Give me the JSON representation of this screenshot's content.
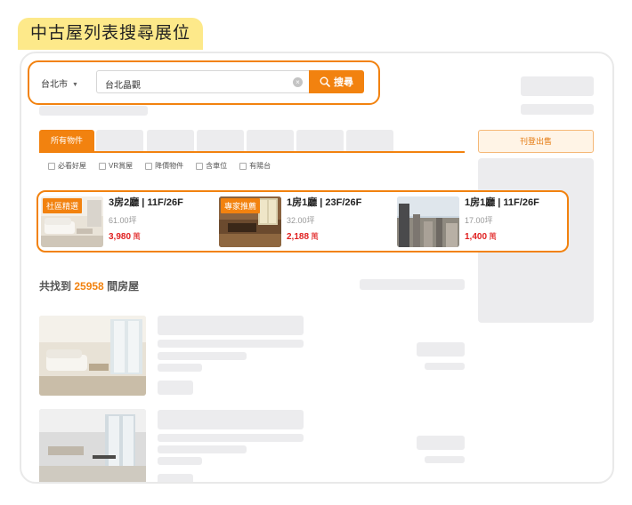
{
  "header": {
    "title": "中古屋列表搜尋展位"
  },
  "search": {
    "city": "台北市",
    "query": "台北晶觀",
    "button_label": "搜尋"
  },
  "tabs": {
    "active_label": "所有物件"
  },
  "filters": [
    "必看好屋",
    "VR賞屋",
    "降價物件",
    "含車位",
    "有陽台"
  ],
  "sidebar": {
    "sell_button_label": "刊登出售"
  },
  "featured": [
    {
      "badge": "社區精選",
      "title": "3房2廳 | 11F/26F",
      "area": "61.00坪",
      "price": "3,980",
      "unit": "萬"
    },
    {
      "badge": "專家推薦",
      "title": "1房1廳 | 23F/26F",
      "area": "32.00坪",
      "price": "2,188",
      "unit": "萬"
    },
    {
      "badge": "",
      "title": "1房1廳 | 11F/26F",
      "area": "17.00坪",
      "price": "1,400",
      "unit": "萬"
    }
  ],
  "results": {
    "prefix": "共找到",
    "count": "25958",
    "suffix": "間房屋"
  },
  "colors": {
    "accent": "#f2820f",
    "price": "#e02020",
    "tag": "#fde98a"
  }
}
